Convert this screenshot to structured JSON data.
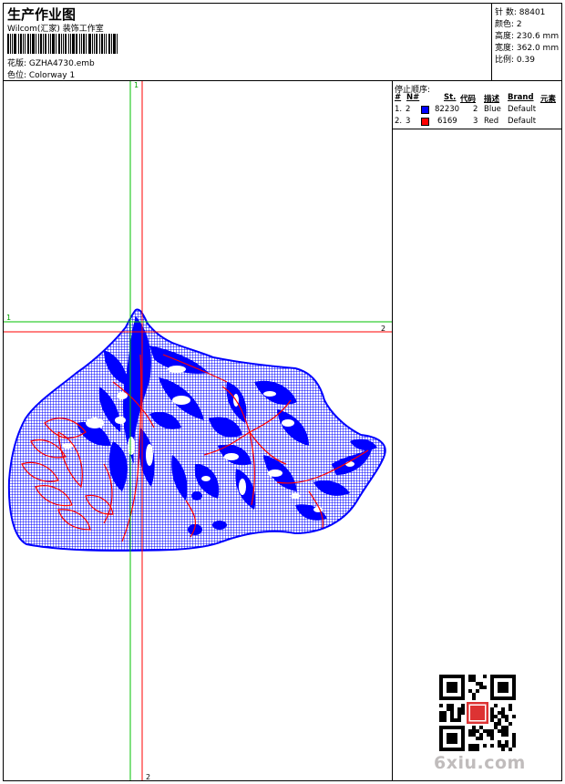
{
  "header": {
    "title": "生产作业图",
    "studio": "Wilcom(汇家) 装饰工作室",
    "design_label": "花版:  GZHA4730.emb",
    "colorway_label": "色位:  Colorway 1"
  },
  "stats": [
    {
      "label": "针 数:",
      "value": "88401"
    },
    {
      "label": "颜色:",
      "value": "2"
    },
    {
      "label": "高度:",
      "value": "230.6 mm"
    },
    {
      "label": "宽度:",
      "value": "362.0 mm"
    },
    {
      "label": "比例:",
      "value": "0.39"
    }
  ],
  "stop_sequence": {
    "title": "停止顺序:",
    "headers": {
      "num": "#",
      "n": "N#",
      "st": "St.",
      "code": "代码",
      "desc": "描述",
      "brand": "Brand",
      "element": "元素"
    },
    "rows": [
      {
        "num": "1.",
        "n": "2",
        "color": "#0000ff",
        "st": "82230",
        "code": "2",
        "desc": "Blue",
        "brand": "Default"
      },
      {
        "num": "2.",
        "n": "3",
        "color": "#ff0000",
        "st": "6169",
        "code": "3",
        "desc": "Red",
        "brand": "Default"
      }
    ]
  },
  "guides": {
    "v1": "1",
    "v2": "2",
    "h1": "1",
    "h2": "2"
  },
  "colors": {
    "blue": "#0000ff",
    "red": "#ff0000",
    "green": "#00c000"
  },
  "watermark": "6xiu.com"
}
